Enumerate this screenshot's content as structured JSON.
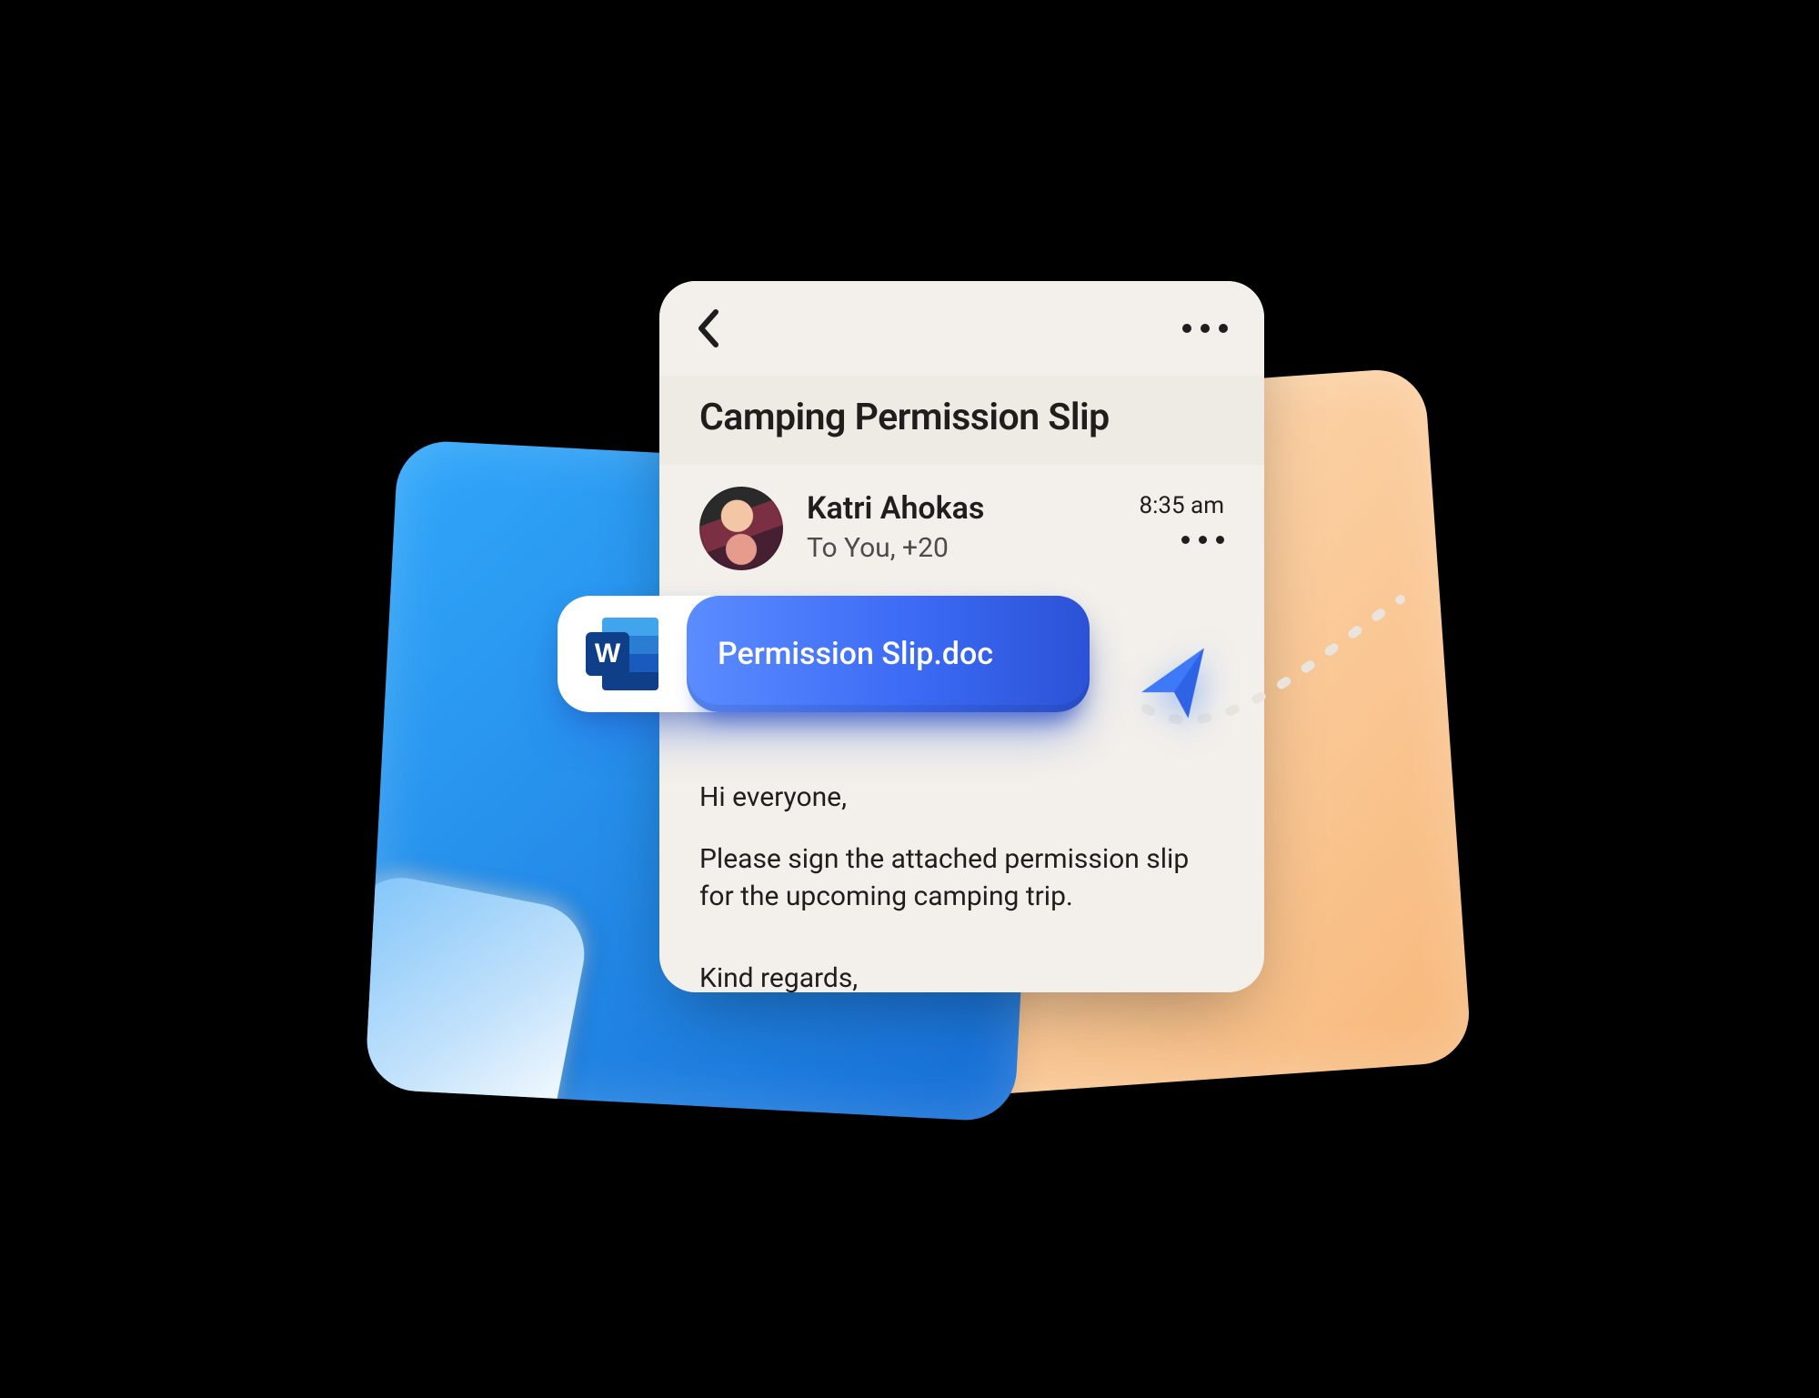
{
  "email": {
    "subject": "Camping Permission Slip",
    "sender_name": "Katri Ahokas",
    "recipients_line": "To You, +20",
    "time": "8:35 am",
    "body_greeting": "Hi everyone,",
    "body_main": "Please sign the attached permission slip for the upcoming camping trip.",
    "body_signoff": "Kind regards,"
  },
  "attachment": {
    "filename": "Permission Slip.doc",
    "app_letter": "W"
  }
}
